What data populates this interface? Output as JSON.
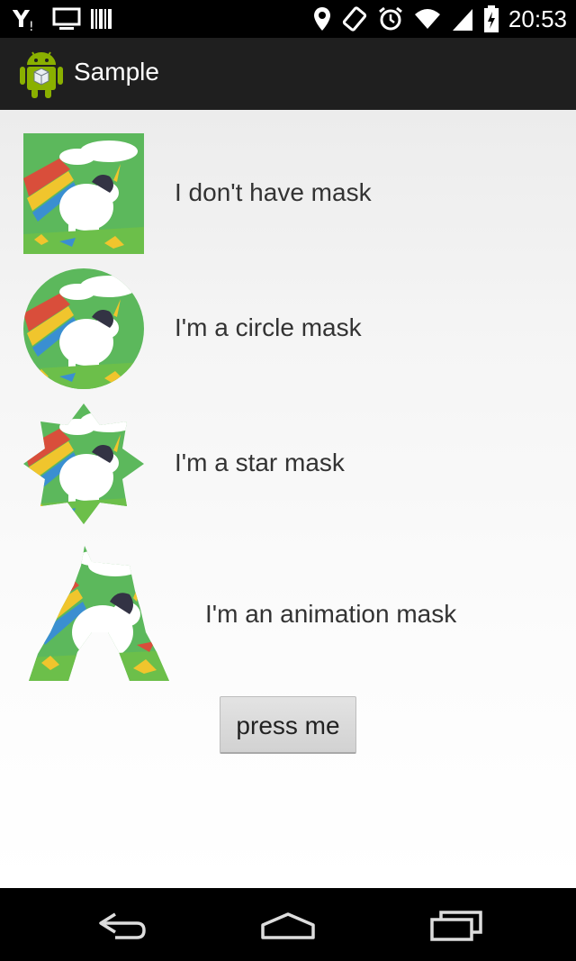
{
  "status_bar": {
    "time": "20:53",
    "icons_left": [
      "yahoo-messenger-icon",
      "monitor-icon",
      "barcode-icon"
    ],
    "icons_right": [
      "location-pin-icon",
      "rotate-icon",
      "alarm-icon",
      "wifi-icon",
      "signal-icon",
      "battery-charging-icon"
    ]
  },
  "action_bar": {
    "title": "Sample",
    "icon": "android-app-icon"
  },
  "rows": [
    {
      "label": "I don't have mask",
      "mask": "none"
    },
    {
      "label": "I'm a circle mask",
      "mask": "circle"
    },
    {
      "label": "I'm a star mask",
      "mask": "star"
    },
    {
      "label": "I'm an animation mask",
      "mask": "animation"
    }
  ],
  "button": {
    "label": "press me"
  },
  "nav_bar": {
    "buttons": [
      "back-icon",
      "home-icon",
      "recent-apps-icon"
    ]
  },
  "colors": {
    "image_green": "#5cb85c",
    "status_bg": "#000000",
    "action_bar_bg": "#1f1f1f",
    "text": "#333333"
  }
}
